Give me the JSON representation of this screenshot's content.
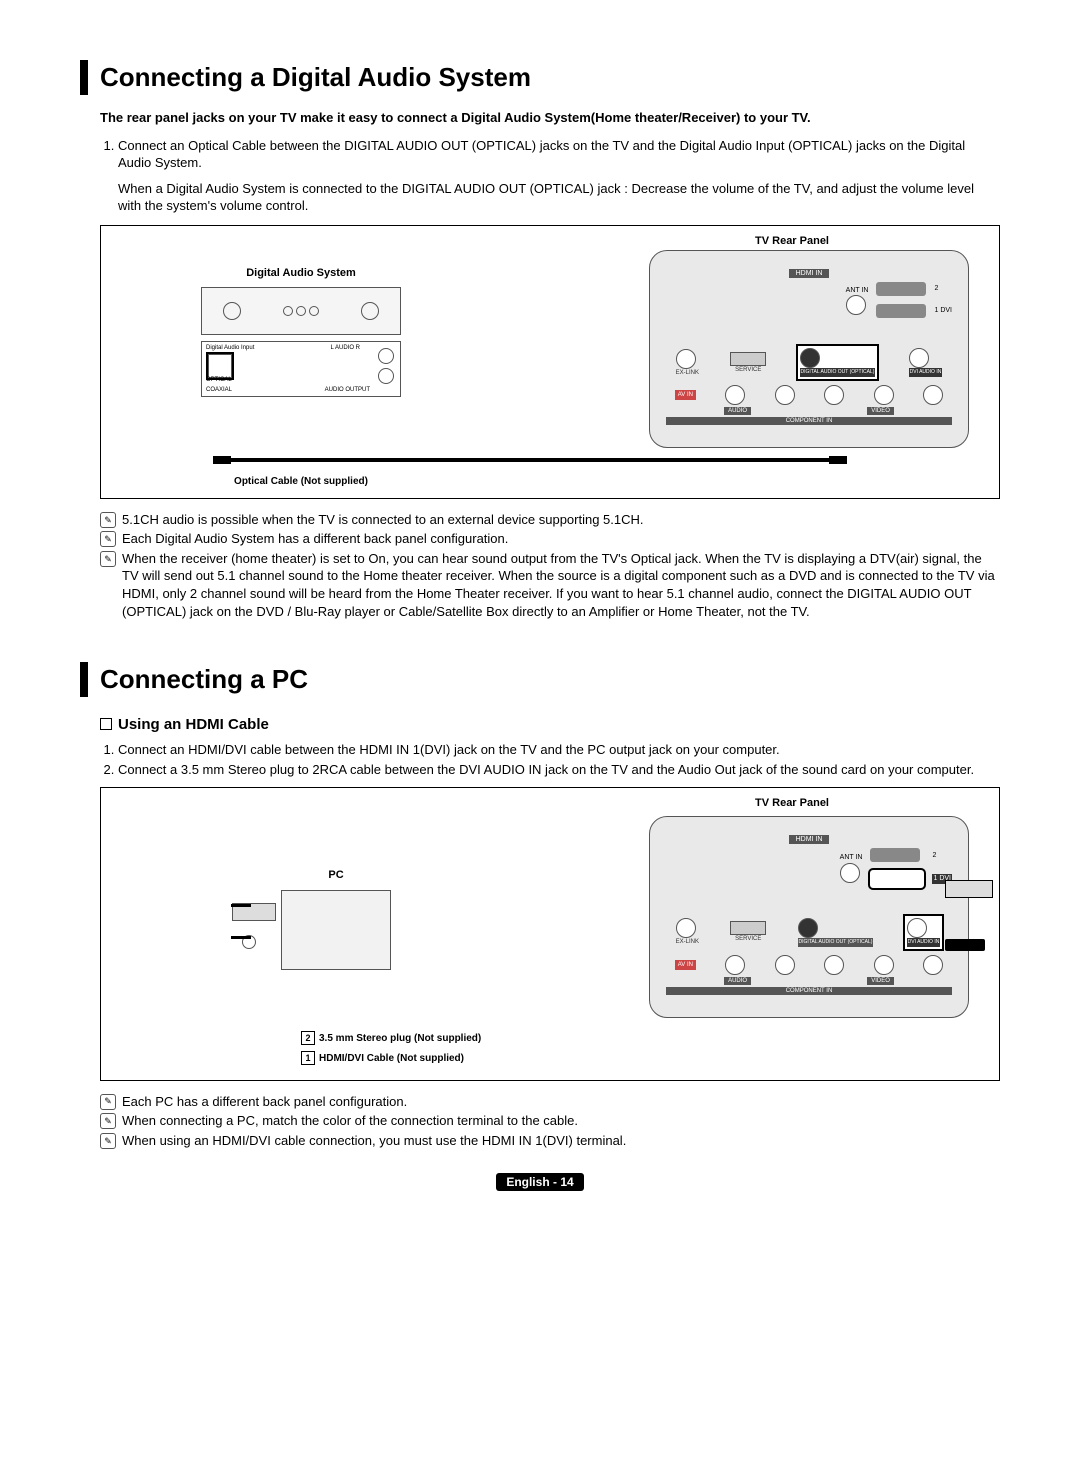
{
  "section1": {
    "title": "Connecting a Digital Audio System",
    "intro": "The rear panel jacks on your TV make it easy to connect a Digital Audio System(Home theater/Receiver) to your TV.",
    "step1": "Connect an Optical Cable between the DIGITAL AUDIO OUT (OPTICAL) jacks on the TV and the Digital Audio Input (OPTICAL) jacks on the Digital Audio System.",
    "step1_note": "When a Digital Audio System is connected to the DIGITAL AUDIO OUT (OPTICAL) jack : Decrease the volume of the TV, and adjust the volume level with the system's volume control.",
    "diagram": {
      "rear_label": "TV Rear Panel",
      "das_label": "Digital Audio System",
      "optical_cable_label": "Optical Cable (Not supplied)",
      "ports": {
        "hdmi_in": "HDMI IN",
        "ant_in": "ANT IN",
        "ex_link": "EX-LINK",
        "service": "SERVICE",
        "digital_audio_out": "DIGITAL AUDIO OUT (OPTICAL)",
        "dvi_audio_in": "DVI AUDIO IN",
        "av_in": "AV IN",
        "audio": "AUDIO",
        "video": "VIDEO",
        "component_in": "COMPONENT IN",
        "port1": "1 DVI",
        "port2": "2"
      },
      "das_ports": {
        "digital_audio_input": "Digital Audio Input",
        "optical": "OPTICAL",
        "coaxial": "COAXIAL",
        "l_audio_r": "L   AUDIO   R",
        "audio_output": "AUDIO OUTPUT"
      }
    },
    "notes": [
      "5.1CH audio is possible when the TV is connected to an external device supporting 5.1CH.",
      "Each Digital Audio System has a different back panel configuration.",
      "When the receiver (home theater) is set to On, you can hear sound output from the TV's Optical jack. When the TV is displaying a DTV(air) signal, the TV will send out 5.1 channel sound to the Home theater receiver. When the source is a digital component such as a DVD and is connected to the TV via HDMI, only 2 channel sound will be heard from the Home Theater receiver. If you want to hear 5.1 channel audio, connect the DIGITAL AUDIO OUT (OPTICAL) jack on the DVD / Blu-Ray player or Cable/Satellite Box directly to an Amplifier or Home Theater, not the TV."
    ]
  },
  "section2": {
    "title": "Connecting a PC",
    "sub_title": "Using an HDMI Cable",
    "steps": [
      "Connect an HDMI/DVI cable between the HDMI IN 1(DVI) jack on the TV and the PC output jack on your computer.",
      "Connect a 3.5 mm Stereo plug to 2RCA cable between the DVI AUDIO IN jack on the TV and the Audio Out jack of the sound card on your computer."
    ],
    "diagram": {
      "rear_label": "TV Rear Panel",
      "pc_label": "PC",
      "cable2_num": "2",
      "cable2_text": "3.5 mm Stereo plug (Not supplied)",
      "cable1_num": "1",
      "cable1_text": "HDMI/DVI Cable (Not supplied)"
    },
    "notes": [
      "Each PC has a different back panel configuration.",
      "When connecting a PC, match the color of the connection terminal to the cable.",
      "When using an HDMI/DVI cable connection, you must use the HDMI IN 1(DVI) terminal."
    ]
  },
  "footer": {
    "lang": "English",
    "sep": " - ",
    "page": "14"
  }
}
